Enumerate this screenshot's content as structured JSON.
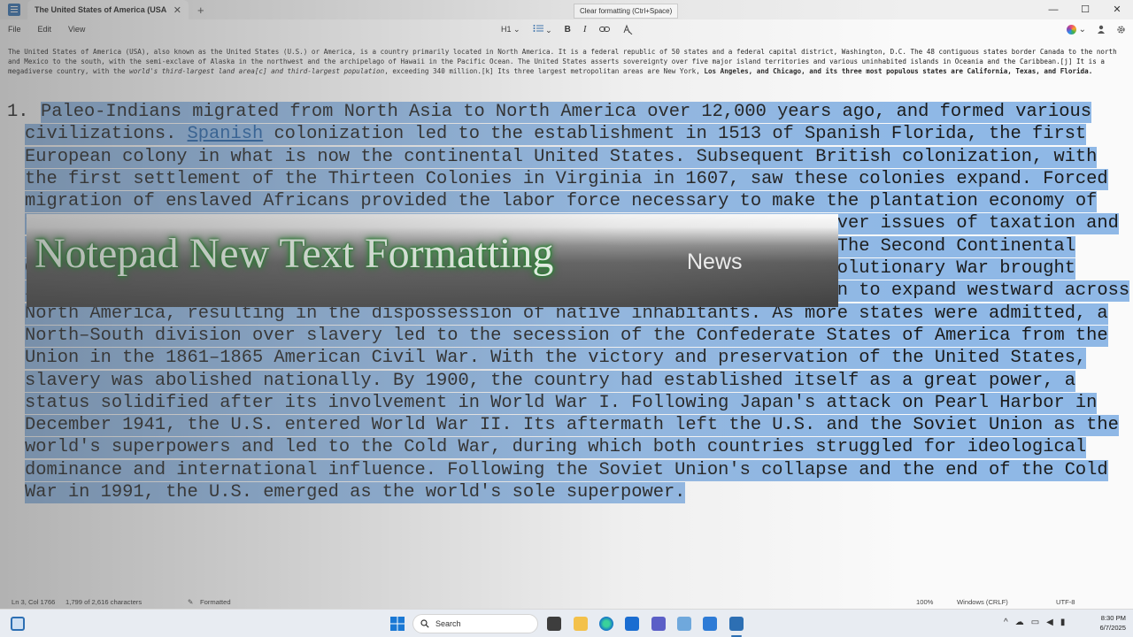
{
  "window": {
    "tab_title": "The United States of America (USA",
    "tab_close": "✕",
    "new_tab": "+",
    "controls": [
      "—",
      "☐",
      "✕"
    ]
  },
  "menu": [
    "File",
    "Edit",
    "View"
  ],
  "toolbar": {
    "heading_label": "H1",
    "heading_chevron": "⌄",
    "list_chevron": "⌄",
    "bold_label": "B",
    "italic_label": "I",
    "link_icon": "link-icon",
    "clear_format_icon": "clear-formatting-icon",
    "tooltip": "Clear formatting (Ctrl+Space)",
    "copilot_chevron": "⌄"
  },
  "document": {
    "paragraph_parts": [
      "The United States of America (USA), also known as the United States (U.S.) or America, is a country primarily located in North America. It is a federal republic of 50 states and a federal capital district, Washington, D.C. The 48 contiguous states border Canada to the north and Mexico to the south, with the semi-exclave of Alaska in the northwest and the archipelago of Hawaii in the Pacific Ocean. The United States asserts sovereignty over five major island territories and various uninhabited islands in Oceania and the Caribbean.[j] It is a megadiverse country, with the ",
      "world's third-largest land area[c] and third-largest population",
      ", exceeding 340 million.[k] Its three largest metropolitan areas are New York, ",
      "Los Angeles, and Chicago, and its three most populous states are California, Texas, and Florida."
    ],
    "list_number": "1.",
    "list_item_before_link": "Paleo-Indians migrated from North Asia to North America over 12,000 years ago, and formed various civilizations. ",
    "list_item_link": "Spanish",
    "list_item_after_link": " colonization led to the establishment in 1513 of Spanish Florida, the first European colony in what is now the continental United States. Subsequent British colonization, with the first settlement of the Thirteen Colonies in Virginia in 1607, saw these colonies expand. Forced migration of enslaved Africans provided the labor force necessary to make the plantation economy of the South. Disputes between the colonies and the Kingdom of Great Britain over issues of taxation and the denial of parliamentary representation led to the American Revolution. The Second Continental Congress formally declared independence on July 4, 1776. Victory in the Revolutionary War brought international recognition. In the late 18th century, the United States began to expand westward across North America, resulting in the dispossession of native inhabitants. As more states were admitted, a North–South division over slavery led to the secession of the Confederate States of America from the Union in the 1861–1865 American Civil War. With the victory and preservation of the United States, slavery was abolished nationally. By 1900, the country had established itself as a great power, a status solidified after its involvement in World War I. Following Japan's attack on Pearl Harbor in December 1941, the U.S. entered World War II. Its aftermath left the U.S. and the Soviet Union as the world's superpowers and led to the Cold War, during which both countries struggled for ideological dominance and international influence. Following the Soviet Union's collapse and the end of the Cold War in 1991, the U.S. emerged as the world's sole superpower."
  },
  "banner": {
    "title": "Notepad New Text Formatting",
    "tag": "News"
  },
  "status": {
    "position": "Ln 3, Col 1766",
    "characters": "1,799 of 2,616 characters",
    "mode": "Formatted",
    "zoom": "100%",
    "line_ending": "Windows (CRLF)",
    "encoding": "UTF-8"
  },
  "taskbar": {
    "search_placeholder": "Search",
    "time": "8:30 PM",
    "date": "6/7/2025",
    "tray_chevron": "^"
  }
}
